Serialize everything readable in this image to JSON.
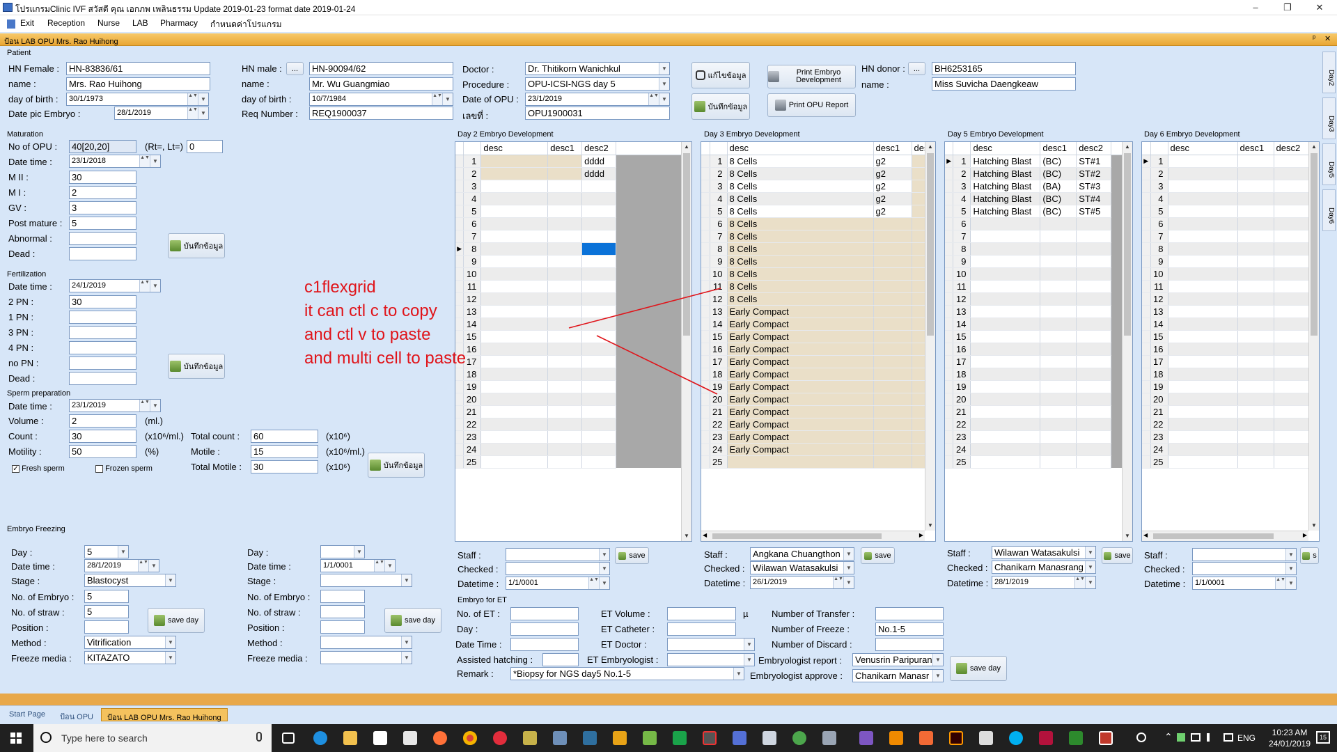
{
  "window": {
    "title": "โปรแกรมClinic IVF สวัสดี คุณ เอกภพ เพลินธรรม Update 2019-01-23 format date 2019-01-24",
    "minimize": "–",
    "maximize": "❐",
    "close": "✕"
  },
  "menu": [
    "Exit",
    "Reception",
    "Nurse",
    "LAB",
    "Pharmacy",
    "กำหนดค่าโปรแกรม"
  ],
  "doc_title": "ป้อน LAB OPU Mrs. Rao Huihong",
  "doc_controls": {
    "pin": "ᵖ",
    "close": "✕"
  },
  "patient": {
    "group": "Patient",
    "hn_female_label": "HN Female :",
    "hn_female": "HN-83836/61",
    "name_label": "name :",
    "name": "Mrs. Rao Huihong",
    "dob_label": "day of birth :",
    "dob": "30/1/1973",
    "date_pic_label": "Date pic Embryo :",
    "date_pic": "28/1/2019",
    "hn_male_label": "HN male :",
    "hn_male": "HN-90094/62",
    "hn_male_btn": "...",
    "male_name_label": "name :",
    "male_name": "Mr. Wu Guangmiao",
    "male_dob_label": "day of birth :",
    "male_dob": "10/7/1984",
    "req_label": "Req Number :",
    "req": "REQ1900037",
    "doctor_label": "Doctor :",
    "doctor": "Dr. Thitikorn Wanichkul",
    "procedure_label": "Procedure :",
    "procedure": "OPU-ICSI-NGS day 5",
    "opu_date_label": "Date of OPU :",
    "opu_date": "23/1/2019",
    "no_label": "เลขที่ :",
    "no": "OPU1900031",
    "edit_btn": "แก้ไขข้อมูล",
    "save_btn": "บันทึกข้อมูล",
    "print_embryo_btn": "Print Embryo Development",
    "print_opu_btn": "Print OPU Report",
    "hn_donor_label": "HN donor :",
    "hn_donor_btn": "...",
    "hn_donor": "BH6253165",
    "donor_name_label": "name :",
    "donor_name": "Miss Suvicha Daengkeaw"
  },
  "maturation": {
    "group": "Maturation",
    "no_opu_label": "No of OPU :",
    "no_opu": "40[20,20]",
    "rt_label": "(Rt=, Lt=)",
    "rt": "0",
    "datetime_label": "Date time :",
    "datetime": "23/1/2018",
    "mii_label": "M II :",
    "mii": "30",
    "mi_label": "M I :",
    "mi": "2",
    "gv_label": "GV :",
    "gv": "3",
    "post_label": "Post mature :",
    "post": "5",
    "abn_label": "Abnormal :",
    "abn": "",
    "dead_label": "Dead :",
    "dead": "",
    "save": "บันทึกข้อมูล"
  },
  "fertilization": {
    "group": "Fertilization",
    "datetime_label": "Date time :",
    "datetime": "24/1/2019",
    "pn2_label": "2 PN :",
    "pn2": "30",
    "pn1_label": "1 PN :",
    "pn3_label": "3 PN :",
    "pn4_label": "4 PN :",
    "nopn_label": "no PN :",
    "dead_label": "Dead :",
    "save": "บันทึกข้อมูล"
  },
  "sperm": {
    "group": "Sperm preparation",
    "datetime_label": "Date time :",
    "datetime": "23/1/2019",
    "volume_label": "Volume :",
    "volume": "2",
    "volume_unit": "(ml.)",
    "count_label": "Count :",
    "count": "30",
    "count_unit": "(x10⁶/ml.)",
    "motility_label": "Motility :",
    "motility": "50",
    "motility_unit": "(%)",
    "total_count_label": "Total count :",
    "total_count": "60",
    "total_count_unit": "(x10⁶)",
    "motile_label": "Motile :",
    "motile": "15",
    "motile_unit": "(x10⁶/ml.)",
    "total_motile_label": "Total Motile :",
    "total_motile": "30",
    "total_motile_unit": "(x10⁶)",
    "fresh_label": "Fresh sperm",
    "fresh_checked": "✓",
    "frozen_label": "Frozen sperm",
    "save": "บันทึกข้อมูล"
  },
  "freezing": {
    "group": "Embryo Freezing",
    "day_label": "Day :",
    "day": "5",
    "datetime_label": "Date time :",
    "datetime": "28/1/2019",
    "stage_label": "Stage :",
    "stage": "Blastocyst",
    "no_embryo_label": "No. of Embryo :",
    "no_embryo": "5",
    "no_straw_label": "No. of straw :",
    "no_straw": "5",
    "position_label": "Position :",
    "position": "",
    "method_label": "Method :",
    "method": "Vitrification",
    "media_label": "Freeze media :",
    "media": "KITAZATO",
    "save": "save day",
    "day2": "",
    "datetime2": "1/1/0001",
    "save2": "save day"
  },
  "day2": {
    "title": "Day 2 Embryo Development",
    "cols": [
      "desc",
      "desc1",
      "desc2"
    ],
    "rows": [
      [
        "",
        "",
        "dddd"
      ],
      [
        "",
        "",
        "dddd"
      ]
    ],
    "staff_label": "Staff :",
    "checked_label": "Checked :",
    "datetime_label": "Datetime :",
    "staff": "",
    "checked": "",
    "datetime": "1/1/0001",
    "save": "save"
  },
  "day3": {
    "title": "Day 3 Embryo Development",
    "cols": [
      "desc",
      "desc1",
      "des"
    ],
    "rows": [
      [
        "8 Cells",
        "g2"
      ],
      [
        "8 Cells",
        "g2"
      ],
      [
        "8 Cells",
        "g2"
      ],
      [
        "8 Cells",
        "g2"
      ],
      [
        "8 Cells",
        "g2"
      ],
      [
        "8 Cells",
        ""
      ],
      [
        "8 Cells",
        ""
      ],
      [
        "8 Cells",
        ""
      ],
      [
        "8 Cells",
        ""
      ],
      [
        "8 Cells",
        ""
      ],
      [
        "8 Cells",
        ""
      ],
      [
        "8 Cells",
        ""
      ],
      [
        "Early Compact",
        ""
      ],
      [
        "Early Compact",
        ""
      ],
      [
        "Early Compact",
        ""
      ],
      [
        "Early Compact",
        ""
      ],
      [
        "Early Compact",
        ""
      ],
      [
        "Early Compact",
        ""
      ],
      [
        "Early Compact",
        ""
      ],
      [
        "Early Compact",
        ""
      ],
      [
        "Early Compact",
        ""
      ],
      [
        "Early Compact",
        ""
      ],
      [
        "Early Compact",
        ""
      ],
      [
        "Early Compact",
        ""
      ]
    ],
    "staff_label": "Staff :",
    "checked_label": "Checked :",
    "datetime_label": "Datetime :",
    "staff": "Angkana Chuangthon",
    "checked": "Wilawan Watasakulsi",
    "datetime": "26/1/2019",
    "save": "save"
  },
  "day5": {
    "title": "Day 5 Embryo Development",
    "cols": [
      "desc",
      "desc1",
      "desc2"
    ],
    "rows": [
      [
        "Hatching Blast",
        "(BC)",
        "ST#1"
      ],
      [
        "Hatching Blast",
        "(BC)",
        "ST#2"
      ],
      [
        "Hatching Blast",
        "(BA)",
        "ST#3"
      ],
      [
        "Hatching Blast",
        "(BC)",
        "ST#4"
      ],
      [
        "Hatching Blast",
        "(BC)",
        "ST#5"
      ]
    ],
    "staff_label": "Staff :",
    "checked_label": "Checked :",
    "datetime_label": "Datetime :",
    "staff": "Wilawan Watasakulsi",
    "checked": "Chanikarn Manasrang",
    "datetime": "28/1/2019",
    "save": "save"
  },
  "day6": {
    "title": "Day 6 Embryo Development",
    "cols": [
      "desc",
      "desc1",
      "desc2"
    ],
    "staff_label": "Staff :",
    "checked_label": "Checked :",
    "datetime_label": "Datetime :",
    "datetime": "1/1/0001",
    "save": "s"
  },
  "et": {
    "group": "Embryo for ET",
    "no_et_label": "No. of ET :",
    "day_label": "Day :",
    "datetime_label": "Date Time :",
    "assisted_label": "Assisted hatching :",
    "remark_label": "Remark :",
    "remark": "*Biopsy for NGS day5 No.1-5",
    "volume_label": "ET Volume :",
    "volume_unit": "µ",
    "catheter_label": "ET Catheter :",
    "doctor_label": "ET Doctor :",
    "embryologist_label": "ET Embryologist :",
    "transfer_label": "Number of Transfer :",
    "freeze_label": "Number of Freeze :",
    "freeze": "No.1-5",
    "discard_label": "Number of Discard :",
    "report_label": "Embryologist report :",
    "report": "Venusrin Paripuran",
    "approve_label": "Embryologist approve :",
    "approve": "Chanikarn Manasr",
    "save": "save day"
  },
  "annotation": [
    "c1flexgrid",
    "it can ctl c to copy",
    "and ctl v to paste",
    "and multi cell to paste"
  ],
  "side_tabs": [
    "Day2",
    "Day3",
    "Day5",
    "Day6"
  ],
  "bottom_tabs": [
    "Start Page",
    "ป้อน OPU",
    "ป้อน LAB OPU Mrs. Rao Huihong"
  ],
  "taskbar": {
    "search": "Type here to search",
    "lang": "ENG",
    "time": "10:23 AM",
    "date": "24/01/2019",
    "notif": "15"
  },
  "colors": {
    "accent": "#0b72d8",
    "tan": "#eadfc8",
    "annotation": "#e0141a"
  }
}
